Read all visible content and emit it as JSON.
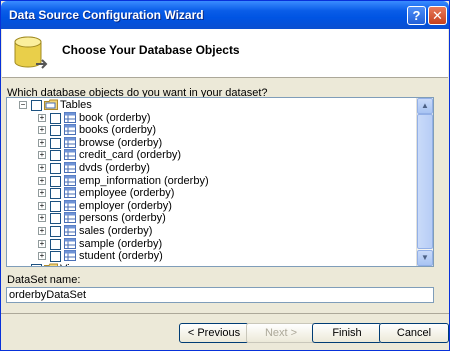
{
  "window": {
    "title": "Data Source Configuration Wizard",
    "help_glyph": "?",
    "close_glyph": "✕"
  },
  "header": {
    "title": "Choose Your Database Objects"
  },
  "prompt": "Which database objects do you want in your dataset?",
  "tree": {
    "root_label": "Tables",
    "root_expander": "−",
    "items": [
      {
        "label": "book (orderby)"
      },
      {
        "label": "books (orderby)"
      },
      {
        "label": "browse (orderby)"
      },
      {
        "label": "credit_card (orderby)"
      },
      {
        "label": "dvds (orderby)"
      },
      {
        "label": "emp_information (orderby)"
      },
      {
        "label": "employee (orderby)"
      },
      {
        "label": "employer (orderby)"
      },
      {
        "label": "persons (orderby)"
      },
      {
        "label": "sales (orderby)"
      },
      {
        "label": "sample (orderby)"
      },
      {
        "label": "student (orderby)"
      }
    ],
    "item_expander": "+",
    "views_label": "Views"
  },
  "dataset": {
    "label": "DataSet name:",
    "value": "orderbyDataSet"
  },
  "buttons": {
    "previous": "< Previous",
    "next": "Next >",
    "finish": "Finish",
    "cancel": "Cancel"
  },
  "scrollbar": {
    "up_glyph": "▲",
    "down_glyph": "▼"
  }
}
